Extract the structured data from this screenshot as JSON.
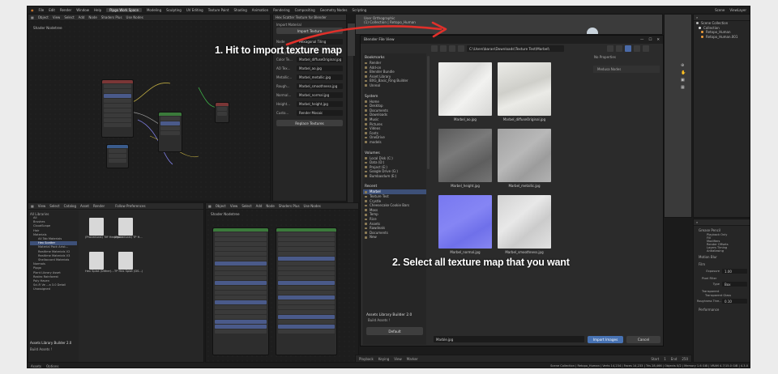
{
  "annotations": {
    "step1": "1. Hit to import texture map",
    "step2": "2. Select all texture map that you want"
  },
  "topbar": {
    "menus": [
      "File",
      "Edit",
      "Render",
      "Window",
      "Help"
    ],
    "workspaces": [
      "Pipgo Work Space",
      "Modeling",
      "Sculpting",
      "UV Editing",
      "Texture Paint",
      "Shading",
      "Animation",
      "Rendering",
      "Compositing",
      "Geometry Nodes",
      "Scripting"
    ],
    "scene": "Scene",
    "view_layer": "ViewLayer"
  },
  "shader_editor_top": {
    "header": [
      "Object",
      "View",
      "Select",
      "Add",
      "Node",
      "Shaders Plus",
      "Use Nodes"
    ],
    "title": "Shader Nodetree"
  },
  "hex_panel": {
    "title": "Hex Scatter Texture for Blender",
    "import_label": "Import Material",
    "import_button": "Import Texture",
    "mode_label": "Node",
    "mode_value": "Hexagonal Tiling",
    "select_label": "Select Textures",
    "rows": [
      {
        "label": "Color Te...",
        "value": "Marbel_diffuseOriginal.jpg"
      },
      {
        "label": "AO Tex...",
        "value": "Marbel_ao.jpg"
      },
      {
        "label": "Metallic...",
        "value": "Marbel_metallic.jpg"
      },
      {
        "label": "Rough...",
        "value": "Marbel_smoothness.jpg"
      },
      {
        "label": "Normal...",
        "value": "Marbel_normal.jpg"
      },
      {
        "label": "Height...",
        "value": "Marbel_height.jpg"
      },
      {
        "label": "Custo...",
        "value": "Render Mosaic"
      }
    ],
    "replace_button": "Replace Textures"
  },
  "viewport_header": [
    "User Orthographic",
    "(1) Collection | Retopo_Human"
  ],
  "asset_browser": {
    "header": [
      "View",
      "Select",
      "Catalog",
      "Asset",
      "Render"
    ],
    "library": "Follow Preferences",
    "all_libraries": "All Libraries",
    "tree": [
      "All",
      "Brushes",
      "CloudScape",
      "Hair",
      "Materials",
      "All Tab Materials",
      "Hex Scatter",
      "Material Pack Artst...",
      "Realtime Materials V2",
      "Realtime Materials V3",
      "Shellaccord Materials",
      "Normals",
      "Pipgo",
      "Plant Library Asset",
      "Rastro Rainforest",
      "Poly Haven",
      "Sci-Fi Ve ...a 3.0 Detail",
      "Unassigned"
    ],
    "items": [
      "(Procedural) Tiff Hexagon",
      "(Procedural) TP H...",
      "Hex Splat (Dither)...",
      "TP Hex Splat (DS...)"
    ],
    "addon": "Assets Library Builder 2.0",
    "build": "Build Assets !"
  },
  "shader_editor_bottom": {
    "header": [
      "Object",
      "View",
      "Select",
      "Add",
      "Node",
      "Shaders Plus",
      "Use Nodes"
    ],
    "title": "Shader Nodetree"
  },
  "file_browser": {
    "title": "Blender File View",
    "path": "C:\\Users\\baran\\Downloads\\Texture Test\\Marbel\\",
    "sections": [
      {
        "name": "Bookmarks",
        "items": [
          "Render",
          "Add-on",
          "Blender Bundle",
          "Asset Library",
          "BXG_Basic_Ring Builder",
          "Unreal"
        ]
      },
      {
        "name": "System",
        "items": [
          "Home",
          "Desktop",
          "Documents",
          "Downloads",
          "Music",
          "Pictures",
          "Videos",
          "Fonts",
          "OneDrive",
          "models"
        ]
      },
      {
        "name": "Volumes",
        "items": [
          "Local Disk (C:)",
          "Data (D:)",
          "Project (E:)",
          "Google Drive (G:)",
          "Bumbasdum (E:)"
        ]
      },
      {
        "name": "Recent",
        "items": [
          "Marbel",
          "Texture Test",
          "Crystle",
          "Cheesecake Cookie Bars",
          "Moss",
          "Temp",
          "Rice",
          "Assets",
          "Rawdeals",
          "Documents",
          "New"
        ]
      }
    ],
    "selected_recent": "Marbel",
    "addon": "Assets Library Builder 2.0",
    "build": "Build Assets !",
    "default_btn": "Default",
    "files": [
      {
        "name": "Marbel_ao.jpg",
        "tone": "#e8e8e6"
      },
      {
        "name": "Marbel_diffuseOriginal.jpg",
        "tone": "#e2e2de"
      },
      {
        "name": "Marbel_height.jpg",
        "tone": "#6c6c6c"
      },
      {
        "name": "Marbel_metallic.jpg",
        "tone": "#a9a9a9"
      },
      {
        "name": "Marbel_normal.jpg",
        "tone": "#7f7ff2"
      },
      {
        "name": "Marbel_smoothness.jpg",
        "tone": "#dcdcdc"
      }
    ],
    "no_properties": "No Properties",
    "sidebar_item": "Medusa Nodes",
    "filename": "Marble.jpg",
    "import_button": "Import Images",
    "cancel_button": "Cancel"
  },
  "outliner": {
    "title": "Scene Collection",
    "items": [
      "Collection",
      "Retopo_Human",
      "Retopo_Human.001"
    ]
  },
  "properties": {
    "sections": [
      "Grease Pencil",
      "Motion Blur",
      "Film",
      "Performance"
    ],
    "grease_items": [
      "Playback Only",
      "Fill",
      "Modifiers",
      "Render Offsets",
      "Layers Timing",
      "Antialiasing"
    ],
    "exposure_label": "Exposure",
    "exposure_value": "1.00",
    "pixel_filter": "Pixel Filter",
    "type_label": "Type",
    "type_value": "Box",
    "transparent": "Transparent",
    "transparent_glass": "Transparent Glass",
    "roughness_label": "Roughness Thre...",
    "roughness_value": "0.10"
  },
  "timeline": {
    "items": [
      "Playback",
      "Keying",
      "View",
      "Marker"
    ],
    "start_label": "Start",
    "start": "1",
    "end_label": "End",
    "end": "250"
  },
  "statusbar": {
    "left": [
      "Assets",
      "Options"
    ],
    "right": "Scene Collection | Retopo_Human | Verts 14,234 | Faces 14,233 | Tris 28,466 | Objects 0/2 | Memory 1.6 GiB | VRAM 4.7/15.0 GiB | 4.3.0"
  }
}
